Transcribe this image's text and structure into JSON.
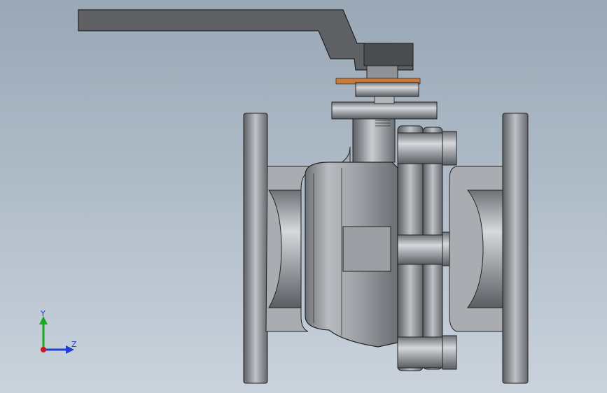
{
  "triad": {
    "y_label": "Y",
    "z_label": "Z",
    "colors": {
      "y": "#18a825",
      "z": "#1f3fd6",
      "x": "#d01818"
    }
  },
  "model": {
    "colors": {
      "handle": "#5e6064",
      "steel_dark": "#3e4044",
      "steel_mid": "#8a8d92",
      "steel_light": "#cfd2d6",
      "gasket": "#c77a3a"
    }
  }
}
